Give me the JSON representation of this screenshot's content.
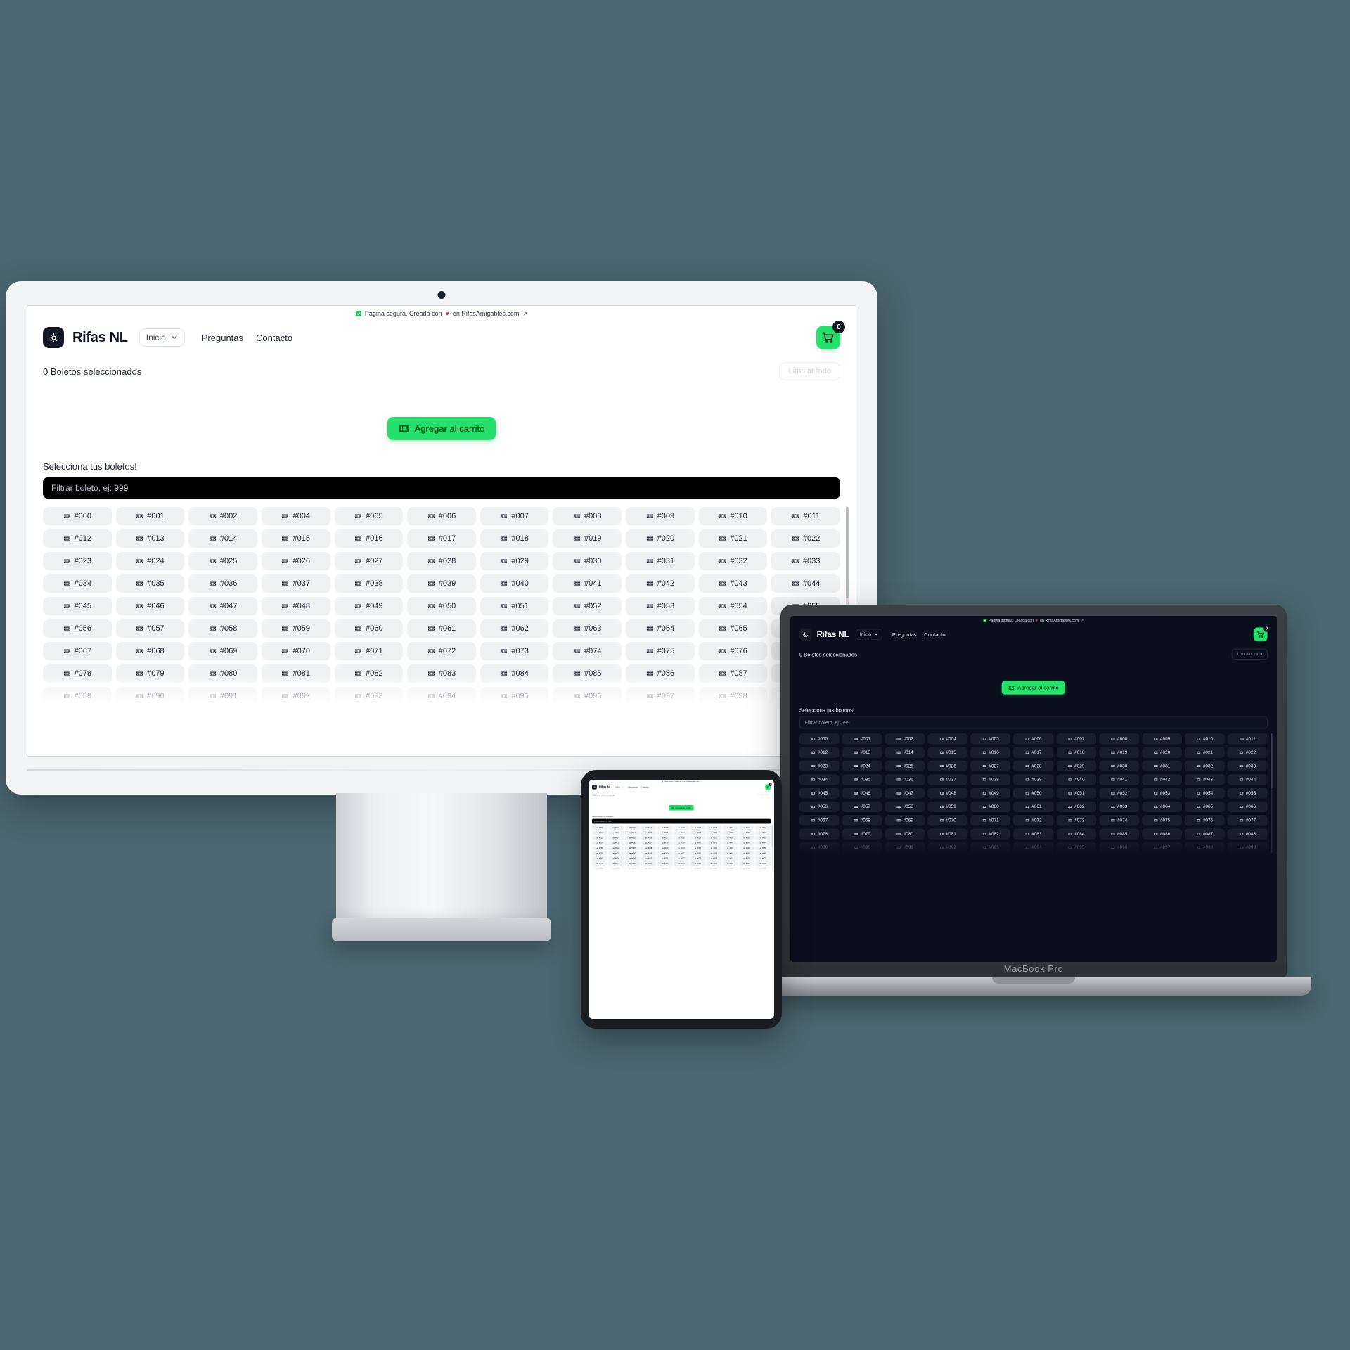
{
  "secure_bar": {
    "text_before": "Página segura. Creada con",
    "heart": "♥",
    "text_after": "en RifasAmigables.com",
    "external_icon": "↗",
    "lock_icon": "shield-check-icon"
  },
  "nav": {
    "brand": "Rifas NL",
    "brand_icon_light": "sun-icon",
    "brand_icon_dark": "moon-icon",
    "select_value": "Inicio",
    "chevron": "▾",
    "links": [
      "Preguntas",
      "Contacto"
    ],
    "cart_icon": "shopping-cart-icon",
    "cart_count": "0"
  },
  "toolbar": {
    "selected_label": "0 Boletos seleccionados",
    "clear_label": "Limpiar todo"
  },
  "cta": {
    "label": "Agregar al carrito",
    "icon": "ticket-icon"
  },
  "tickets_section": {
    "title": "Selecciona tus boletos!",
    "filter_placeholder": "Filtrar boleto, ej: 999",
    "ticket_icon": "ticket-icon",
    "rows": [
      [
        "#000",
        "#001",
        "#002",
        "#004",
        "#005",
        "#006",
        "#007",
        "#008",
        "#009",
        "#010",
        "#011"
      ],
      [
        "#012",
        "#013",
        "#014",
        "#015",
        "#016",
        "#017",
        "#018",
        "#019",
        "#020",
        "#021",
        "#022"
      ],
      [
        "#023",
        "#024",
        "#025",
        "#026",
        "#027",
        "#028",
        "#029",
        "#030",
        "#031",
        "#032",
        "#033"
      ],
      [
        "#034",
        "#035",
        "#036",
        "#037",
        "#038",
        "#039",
        "#040",
        "#041",
        "#042",
        "#043",
        "#044"
      ],
      [
        "#045",
        "#046",
        "#047",
        "#048",
        "#049",
        "#050",
        "#051",
        "#052",
        "#053",
        "#054",
        "#055"
      ],
      [
        "#056",
        "#057",
        "#058",
        "#059",
        "#060",
        "#061",
        "#062",
        "#063",
        "#064",
        "#065",
        "#066"
      ],
      [
        "#067",
        "#068",
        "#069",
        "#070",
        "#071",
        "#072",
        "#073",
        "#074",
        "#075",
        "#076",
        "#077"
      ],
      [
        "#078",
        "#079",
        "#080",
        "#081",
        "#082",
        "#083",
        "#084",
        "#085",
        "#086",
        "#087",
        "#088"
      ],
      [
        "#089",
        "#090",
        "#091",
        "#092",
        "#093",
        "#094",
        "#095",
        "#096",
        "#097",
        "#098",
        "#099"
      ]
    ]
  },
  "devices": {
    "laptop_label": "MacBook Pro"
  },
  "colors": {
    "accent_green": "#22e06a",
    "badge_dark": "#121826",
    "page_background": "#4b6670",
    "dark_screen": "#0a0f1d",
    "light_screen": "#ffffff",
    "heart_red": "#e0263c"
  }
}
